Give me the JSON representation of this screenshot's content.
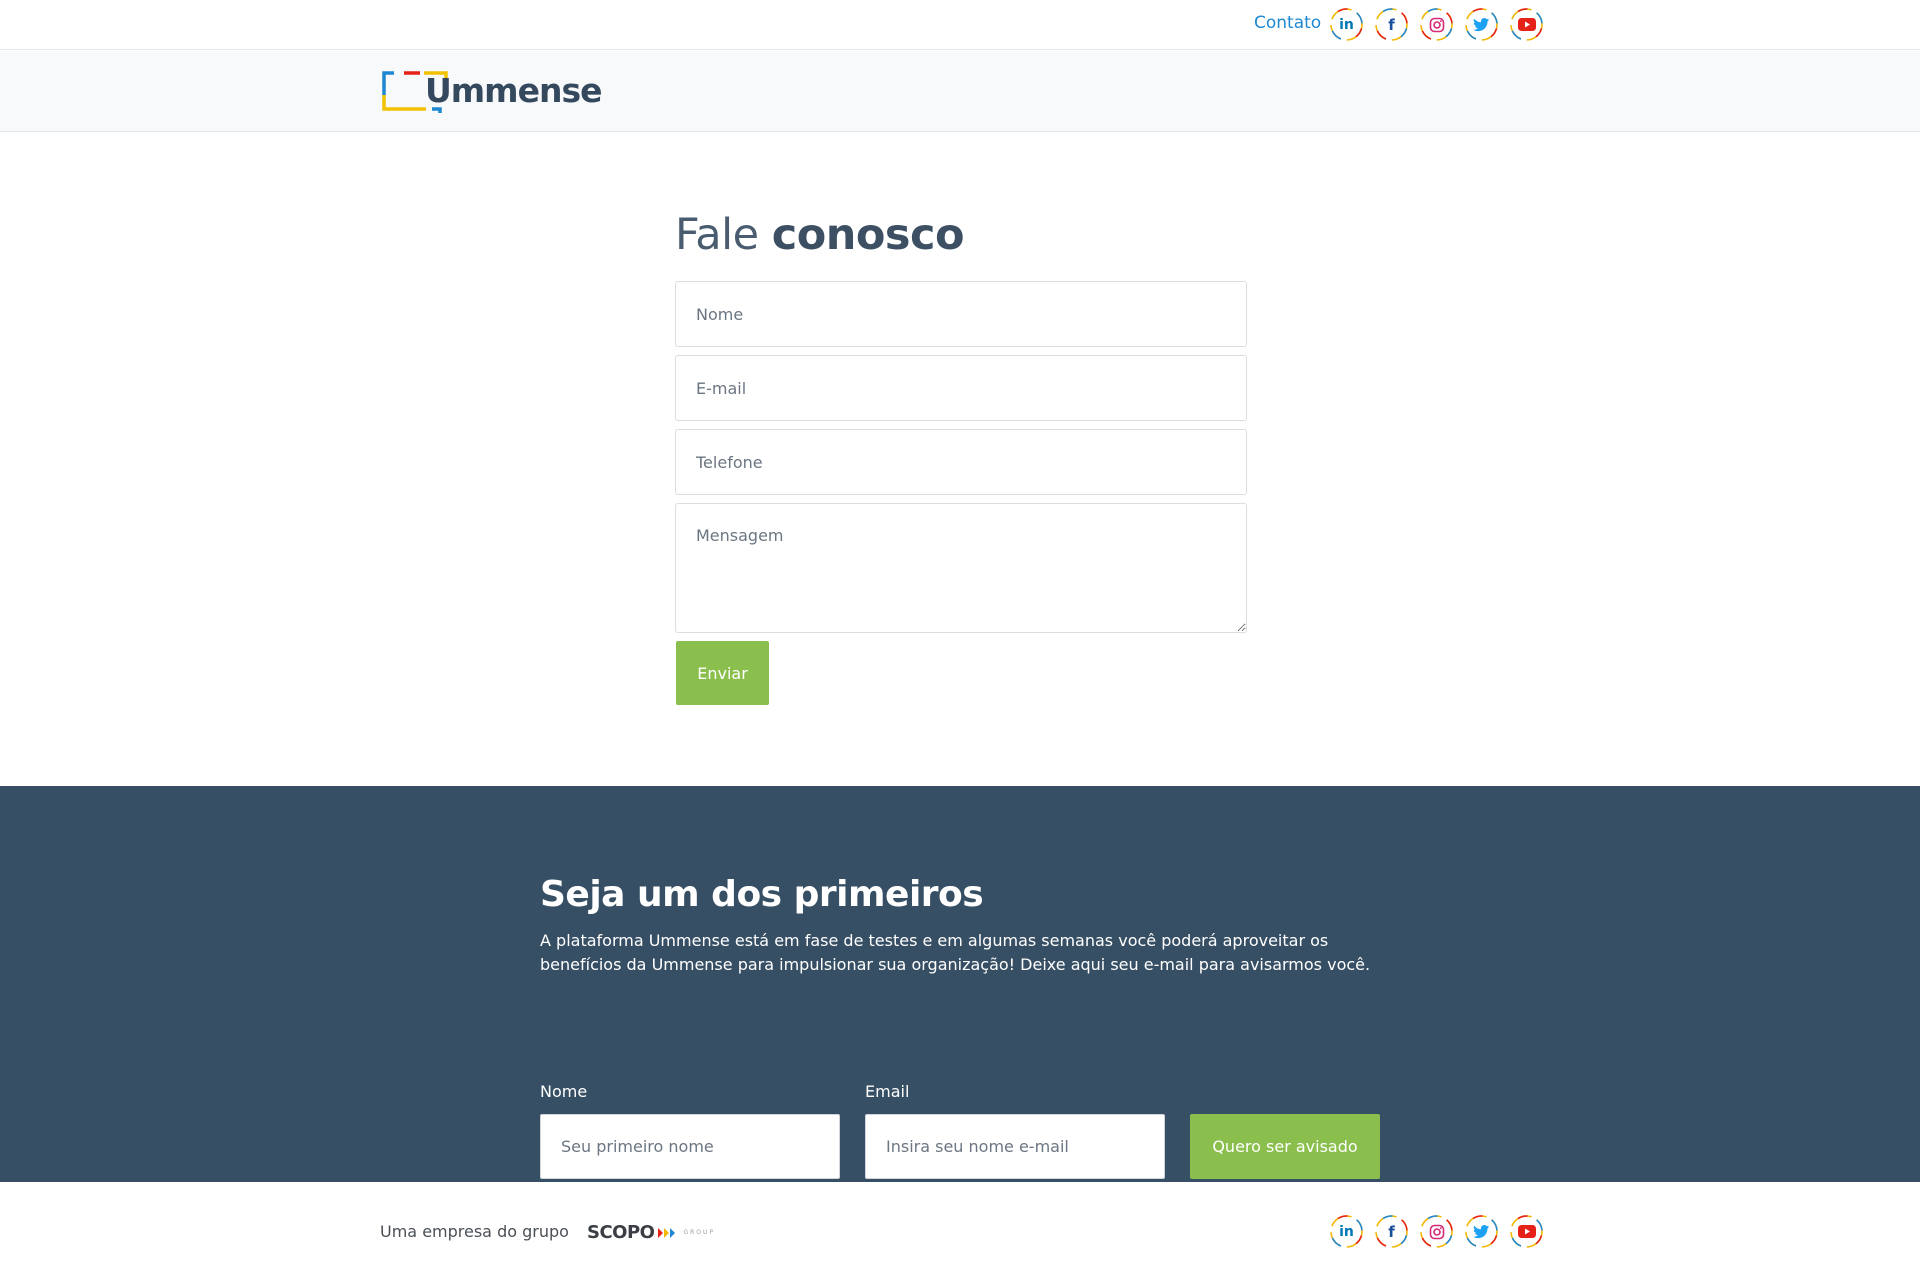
{
  "topbar": {
    "contact_label": "Contato",
    "social": [
      {
        "name": "linkedin",
        "glyph": "in",
        "color": "#0077b5"
      },
      {
        "name": "facebook",
        "glyph": "f",
        "color": "#1a4f9c"
      },
      {
        "name": "instagram",
        "glyph": "◎",
        "color": "#d62976"
      },
      {
        "name": "twitter",
        "glyph": "🐦",
        "color": "#1da1f2"
      },
      {
        "name": "youtube",
        "glyph": "▶",
        "color": "#e62117"
      }
    ]
  },
  "header": {
    "logo_text": "Ummense"
  },
  "contact": {
    "title_light": "Fale",
    "title_bold": "conosco",
    "name_placeholder": "Nome",
    "email_placeholder": "E-mail",
    "phone_placeholder": "Telefone",
    "message_placeholder": "Mensagem",
    "submit_label": "Enviar"
  },
  "newsletter": {
    "title": "Seja um dos primeiros",
    "description": "A plataforma Ummense está em fase de testes e em algumas semanas você poderá aproveitar os benefícios da Ummense para impulsionar sua organização! Deixe aqui seu e-mail para avisarmos você.",
    "name_label": "Nome",
    "name_placeholder": "Seu primeiro nome",
    "email_label": "Email",
    "email_placeholder": "Insira seu nome e-mail",
    "button_label": "Quero ser avisado"
  },
  "footer": {
    "group_text": "Uma empresa do grupo",
    "brand_word": "SCOPO",
    "brand_sub": "GROUP"
  },
  "colors": {
    "accent_green": "#8bbf4d",
    "band_bg": "#374f64",
    "link_blue": "#1e88d2"
  }
}
